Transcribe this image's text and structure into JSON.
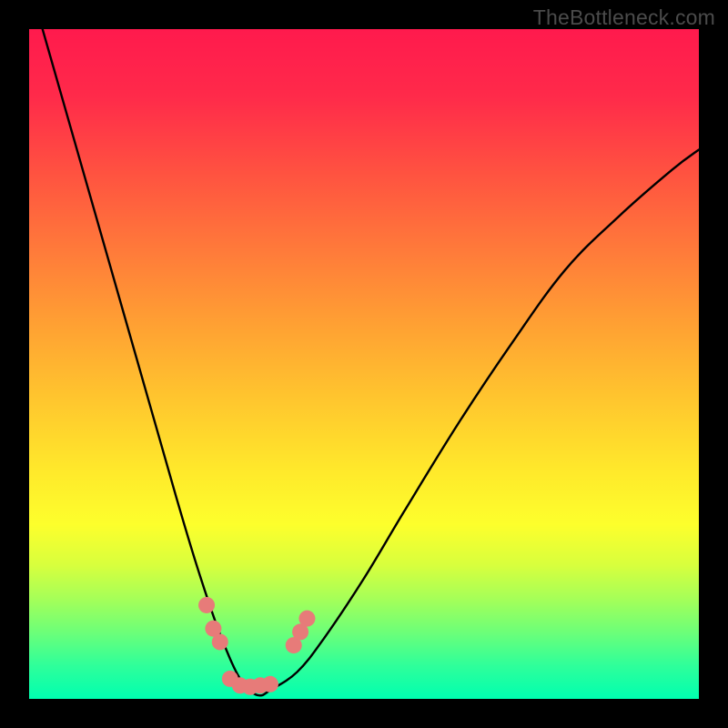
{
  "watermark": "TheBottleneck.com",
  "colors": {
    "gradient_top": "#ff1a4d",
    "gradient_mid": "#ffe92b",
    "gradient_bottom": "#00ffb0",
    "curve": "#000000",
    "marker": "#e77b79",
    "frame": "#000000"
  },
  "chart_data": {
    "type": "line",
    "title": "",
    "xlabel": "",
    "ylabel": "",
    "xlim": [
      0,
      100
    ],
    "ylim": [
      0,
      100
    ],
    "grid": false,
    "legend": false,
    "series": [
      {
        "name": "bottleneck-curve",
        "x": [
          2,
          6,
          10,
          14,
          18,
          22,
          25,
          28,
          30,
          31.5,
          33,
          34.5,
          36,
          40,
          44,
          50,
          56,
          64,
          72,
          80,
          88,
          96,
          100
        ],
        "y": [
          100,
          86,
          72,
          58,
          44,
          30,
          20,
          11,
          6,
          3,
          1.2,
          0.5,
          1.3,
          4,
          9,
          18,
          28,
          41,
          53,
          64,
          72,
          79,
          82
        ]
      }
    ],
    "markers": [
      {
        "x": 26.5,
        "y": 14.0
      },
      {
        "x": 27.5,
        "y": 10.5
      },
      {
        "x": 28.5,
        "y": 8.5
      },
      {
        "x": 30.0,
        "y": 3.0
      },
      {
        "x": 31.5,
        "y": 2.0
      },
      {
        "x": 33.0,
        "y": 1.8
      },
      {
        "x": 34.5,
        "y": 2.0
      },
      {
        "x": 36.0,
        "y": 2.2
      },
      {
        "x": 39.5,
        "y": 8.0
      },
      {
        "x": 40.5,
        "y": 10.0
      },
      {
        "x": 41.5,
        "y": 12.0
      }
    ]
  }
}
